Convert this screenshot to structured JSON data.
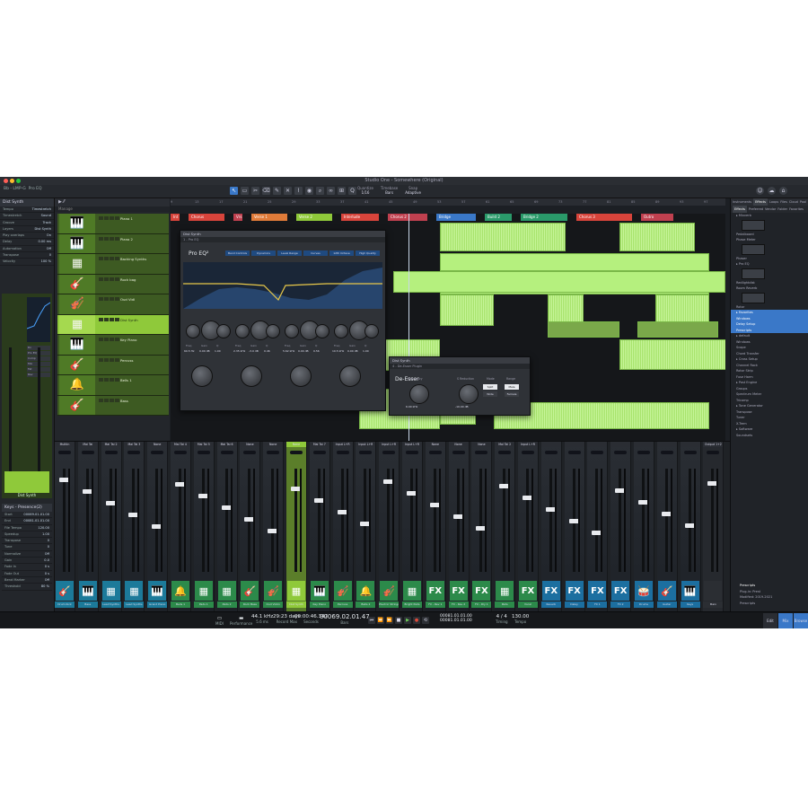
{
  "window": {
    "title": "Studio One - Somewhere (Original)",
    "colors": {
      "accent": "#3a78c8",
      "track": "#8fc93a",
      "clip": "#b5f07e",
      "background": "#1c1f24"
    }
  },
  "toolbar": {
    "track_label": "Bb - LMP-G",
    "track_sub": "Pro EQ",
    "tools": [
      {
        "icon": "pointer-icon",
        "glyph": "↖"
      },
      {
        "icon": "range-icon",
        "glyph": "▭"
      },
      {
        "icon": "split-icon",
        "glyph": "✂"
      },
      {
        "icon": "eraser-icon",
        "glyph": "⌫"
      },
      {
        "icon": "paint-icon",
        "glyph": "✎"
      },
      {
        "icon": "mute-icon",
        "glyph": "✕"
      },
      {
        "icon": "bend-icon",
        "glyph": "⌇"
      },
      {
        "icon": "listen-icon",
        "glyph": "◉"
      },
      {
        "icon": "zoom-icon",
        "glyph": "⌕"
      },
      {
        "icon": "link-icon",
        "glyph": "∞"
      },
      {
        "icon": "snap-icon",
        "glyph": "⊞"
      },
      {
        "icon": "quantize-icon",
        "glyph": "Q"
      }
    ],
    "params": [
      {
        "label": "Quantize",
        "value": "1/16"
      },
      {
        "label": "Timebase",
        "value": "Bars"
      },
      {
        "label": "Snap",
        "value": "Adaptive"
      }
    ]
  },
  "inspector": {
    "title": "Dist Synth",
    "rows": [
      {
        "k": "Tempo",
        "v": "Timestretch"
      },
      {
        "k": "Timestretch",
        "v": "Sound"
      },
      {
        "k": "Groove",
        "v": "Track"
      },
      {
        "k": "Layers",
        "v": "Dist Synth"
      },
      {
        "k": "Play overlaps",
        "v": "On"
      },
      {
        "k": "Delay",
        "v": "0.00 ms"
      },
      {
        "k": "Automation",
        "v": "Off"
      },
      {
        "k": "Transpose",
        "v": "0"
      },
      {
        "k": "Velocity",
        "v": "100 %"
      }
    ],
    "channel_label": "Dist Synth",
    "channel_slots": [
      "Rx",
      "Pro EQ",
      "Comp",
      "Mix",
      "Fat",
      "Rev"
    ],
    "bottom_title": "Keys - Presence(2)",
    "bottom_rows": [
      {
        "k": "Start",
        "v": "00069.01.01.00"
      },
      {
        "k": "End",
        "v": "00081.01.01.00"
      },
      {
        "k": "File Tempo",
        "v": "120.00"
      },
      {
        "k": "Speedup",
        "v": "1.00"
      },
      {
        "k": "Transpose",
        "v": "0"
      },
      {
        "k": "Tune",
        "v": "0"
      },
      {
        "k": "Normalize",
        "v": "Off"
      },
      {
        "k": "Gain",
        "v": "0.0"
      },
      {
        "k": "Fade In",
        "v": "0 s"
      },
      {
        "k": "Fade Out",
        "v": "0 s"
      },
      {
        "k": "Bend Marker",
        "v": "Off"
      },
      {
        "k": "Threshold",
        "v": "80 %"
      }
    ]
  },
  "tracklist": {
    "title": "Manage",
    "tracks": [
      {
        "name": "Piano 1",
        "glyph": "🎹"
      },
      {
        "name": "Piano 2",
        "glyph": "🎹"
      },
      {
        "name": "Backing Synths",
        "glyph": "▦"
      },
      {
        "name": "Rock bag",
        "glyph": "🎸"
      },
      {
        "name": "Oud Vidl",
        "glyph": "🎻"
      },
      {
        "name": "Dist Synth",
        "glyph": "▦"
      },
      {
        "name": "Key Piano",
        "glyph": "🎹"
      },
      {
        "name": "Percuss",
        "glyph": "🎸"
      },
      {
        "name": "Bells 1",
        "glyph": "🔔"
      },
      {
        "name": "Bass",
        "glyph": "🎸"
      }
    ]
  },
  "ruler": {
    "bars": [
      "9",
      "13",
      "17",
      "21",
      "25",
      "29",
      "33",
      "37",
      "41",
      "45",
      "49",
      "53",
      "57",
      "61",
      "65",
      "69",
      "73",
      "77",
      "81",
      "85",
      "89",
      "93",
      "97"
    ]
  },
  "markers": [
    {
      "label": "Int 1",
      "color": "#d8443b"
    },
    {
      "label": "Chorus",
      "color": "#d8443b"
    },
    {
      "label": "Vrs",
      "color": "#c0404f"
    },
    {
      "label": "Verse 1",
      "color": "#e07b39"
    },
    {
      "label": "Verse 2",
      "color": "#8fc93a"
    },
    {
      "label": "Interlude",
      "color": "#d8443b"
    },
    {
      "label": "Chorus 2",
      "color": "#c0404f"
    },
    {
      "label": "Bridge",
      "color": "#3a78c8"
    },
    {
      "label": "Build 2",
      "color": "#2a9a6a"
    },
    {
      "label": "Bridge 2",
      "color": "#2a9a6a"
    },
    {
      "label": "Chorus 3",
      "color": "#d8443b"
    },
    {
      "label": "Outro",
      "color": "#c0404f"
    }
  ],
  "plugins": {
    "eq": {
      "window": "Dist Synth",
      "preset": "1 - Pro EQ",
      "title": "Pro EQ²",
      "buttons": [
        "Band Controls",
        "Dynamics",
        "Level Range",
        "Curves",
        "12th Octave",
        "High Quality"
      ],
      "labels": [
        "Freq",
        "Gain",
        "Q",
        "Freq",
        "Gain",
        "Q",
        "Freq",
        "Gain",
        "Q",
        "Freq",
        "Gain",
        "Q"
      ],
      "values": [
        "60.5 Hz",
        "0.00 dB",
        "1.00",
        "2.35 kHz",
        "-3.0 dB",
        "0.46",
        "5.62 kHz",
        "0.00 dB",
        "0.56",
        "10.5 kHz",
        "0.00 dB",
        "1.00"
      ]
    },
    "deesser": {
      "window": "Dist Synth",
      "preset": "4 - De-Esser Plugin",
      "title": "De-Esser",
      "knob_labels": [
        "Frequency",
        "S Reduction"
      ],
      "knob_values": [
        "6.00 kHz",
        "-10.00 dB"
      ],
      "mode_label": "Mode",
      "mode_values": [
        "Split",
        "Wide"
      ],
      "range_label": "Range",
      "range_values": [
        "Male",
        "Female"
      ]
    }
  },
  "mixer": {
    "strips": [
      {
        "top": "Multiin",
        "bottom": "Drum Kick",
        "glyph": "🎸",
        "color": "#1c7a9a"
      },
      {
        "top": "Mai Tai",
        "bottom": "Bass",
        "glyph": "🎹",
        "color": "#1c7a9a"
      },
      {
        "top": "Mai Tai 2",
        "bottom": "Lead Synths",
        "glyph": "▦",
        "color": "#1c7a9a"
      },
      {
        "top": "Mai Tai 3",
        "bottom": "Lead Synths",
        "glyph": "▦",
        "color": "#1c7a9a"
      },
      {
        "top": "None",
        "bottom": "Grand Piano",
        "glyph": "🎹",
        "color": "#1c7a9a"
      },
      {
        "top": "Mai Tai 4",
        "bottom": "Bells 1",
        "glyph": "🔔",
        "color": "#2c8a4a"
      },
      {
        "top": "Mai Tai 5",
        "bottom": "Pads 1",
        "glyph": "▦",
        "color": "#2c8a4a"
      },
      {
        "top": "Mai Tai 6",
        "bottom": "Pads 2",
        "glyph": "▦",
        "color": "#2c8a4a"
      },
      {
        "top": "None",
        "bottom": "Rock Bass",
        "glyph": "🎸",
        "color": "#2c8a4a"
      },
      {
        "top": "None",
        "bottom": "Oud Violin",
        "glyph": "🎻",
        "color": "#2c8a4a"
      },
      {
        "top": "None",
        "bottom": "Dist Synth",
        "glyph": "▦",
        "color": "#8fc93a",
        "selected": true
      },
      {
        "top": "Mai Tai 7",
        "bottom": "Key Piano",
        "glyph": "🎹",
        "color": "#2c8a4a"
      },
      {
        "top": "Input L+R",
        "bottom": "Percuss",
        "glyph": "🎻",
        "color": "#2c8a4a"
      },
      {
        "top": "Input L+R",
        "bottom": "Bells 2",
        "glyph": "🔔",
        "color": "#2c8a4a"
      },
      {
        "top": "Input L+R",
        "bottom": "Electric Strings",
        "glyph": "🎻",
        "color": "#2c8a4a"
      },
      {
        "top": "Input L+R",
        "bottom": "Bright Pads",
        "glyph": "▦",
        "color": "#2c8a4a"
      },
      {
        "top": "None",
        "bottom": "FX - Rev 1",
        "glyph": "FX",
        "color": "#2c8a4a"
      },
      {
        "top": "None",
        "bottom": "FX - Rev 2",
        "glyph": "FX",
        "color": "#2c8a4a"
      },
      {
        "top": "None",
        "bottom": "FX - Dly 1",
        "glyph": "FX",
        "color": "#2c8a4a"
      },
      {
        "top": "Mai Tai 2",
        "bottom": "Pads",
        "glyph": "▦",
        "color": "#2c8a4a"
      },
      {
        "top": "Input L+R",
        "bottom": "Vocal",
        "glyph": "FX",
        "color": "#2c8a4a"
      },
      {
        "top": "",
        "bottom": "Reverb",
        "glyph": "FX",
        "color": "#1c6fa0"
      },
      {
        "top": "",
        "bottom": "Delay",
        "glyph": "FX",
        "color": "#1c6fa0"
      },
      {
        "top": "",
        "bottom": "FX 1",
        "glyph": "FX",
        "color": "#1c6fa0"
      },
      {
        "top": "",
        "bottom": "FX 2",
        "glyph": "FX",
        "color": "#1c6fa0"
      },
      {
        "top": "",
        "bottom": "Drums",
        "glyph": "🥁",
        "color": "#1c6fa0"
      },
      {
        "top": "",
        "bottom": "Guitar",
        "glyph": "🎸",
        "color": "#1c6fa0"
      },
      {
        "top": "",
        "bottom": "Keys",
        "glyph": "🎹",
        "color": "#1c6fa0"
      },
      {
        "top": "Output 1+2",
        "bottom": "Main",
        "glyph": "",
        "color": "#2b2e33"
      }
    ]
  },
  "browser": {
    "tabs": [
      "Instruments",
      "Effects",
      "Loops",
      "Files",
      "Cloud",
      "Pool"
    ],
    "active_tab": "Effects",
    "subtabs": [
      "Effects",
      "Preferred",
      "Vendor",
      "Folder",
      "Favorites"
    ],
    "items": [
      "Mixverb",
      "Pedalboard",
      "Phase Meter",
      "Phaser",
      "Pro EQ",
      "Redlightdist",
      "Room Reverb",
      "Rotor",
      "Favorites",
      "Windows",
      "Delay Setup",
      "Prescripts",
      "default",
      "Windows",
      "Scope",
      "Chord Transfer",
      "Cross Setup",
      "Channel Rack",
      "Rotor Strip",
      "Fuse Harm",
      "Post Engine",
      "Groups",
      "Spectrum Meter",
      "Tricomp",
      "Tone Generator",
      "Transpose",
      "Tuner",
      "X-Trem",
      "Software",
      "Soundsets"
    ],
    "selected_items": [
      "Favorites",
      "Windows",
      "Delay Setup",
      "Prescripts"
    ],
    "info_title": "Prescripts",
    "info_rows": [
      "Plug-in: Prest",
      "Modified: 2019-2021",
      "Prescripts"
    ],
    "bottom_tabs": [
      "Edit",
      "Mix",
      "Browse"
    ]
  },
  "transport": {
    "midi_label": "MIDI",
    "performance_label": "Performance",
    "rate": "44.1 kHz",
    "rate_sub": "5.6 ms",
    "record_max": "29:23 days",
    "record_label": "Record Max",
    "seconds": "00:00:46.347",
    "seconds_label": "Seconds",
    "bars": "00069.02.01.47",
    "bars_label": "Bars",
    "loop_start": "00081.01.01.00",
    "loop_end": "00081.01.01.00",
    "time_sig": "4 / 4",
    "time_sig_label": "Timing",
    "tempo": "130.00",
    "tempo_label": "Tempo",
    "buttons": [
      "⏮",
      "⏪",
      "⏩",
      "■",
      "▶",
      "●",
      "⟲"
    ]
  }
}
